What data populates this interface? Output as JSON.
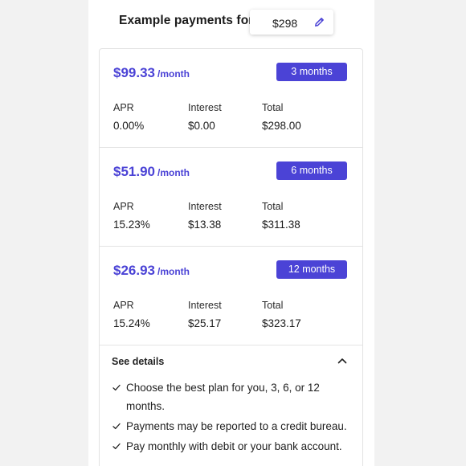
{
  "header": {
    "title": "Example payments for",
    "amount": "$298",
    "edit_icon": "pencil-icon"
  },
  "accent_color": "#4b43d6",
  "plans": [
    {
      "price": "$99.33",
      "per": "/month",
      "term": "3 months",
      "apr_label": "APR",
      "apr": "0.00%",
      "interest_label": "Interest",
      "interest": "$0.00",
      "total_label": "Total",
      "total": "$298.00"
    },
    {
      "price": "$51.90",
      "per": "/month",
      "term": "6 months",
      "apr_label": "APR",
      "apr": "15.23%",
      "interest_label": "Interest",
      "interest": "$13.38",
      "total_label": "Total",
      "total": "$311.38"
    },
    {
      "price": "$26.93",
      "per": "/month",
      "term": "12 months",
      "apr_label": "APR",
      "apr": "15.24%",
      "interest_label": "Interest",
      "interest": "$25.17",
      "total_label": "Total",
      "total": "$323.17"
    }
  ],
  "details": {
    "title": "See details",
    "toggle_icon": "chevron-up-icon",
    "bullet_icon": "check-icon",
    "bullets": [
      "Choose the best plan for you, 3, 6, or 12 months.",
      "Payments may be reported to a credit bureau.",
      "Pay monthly with debit or your bank account."
    ]
  }
}
